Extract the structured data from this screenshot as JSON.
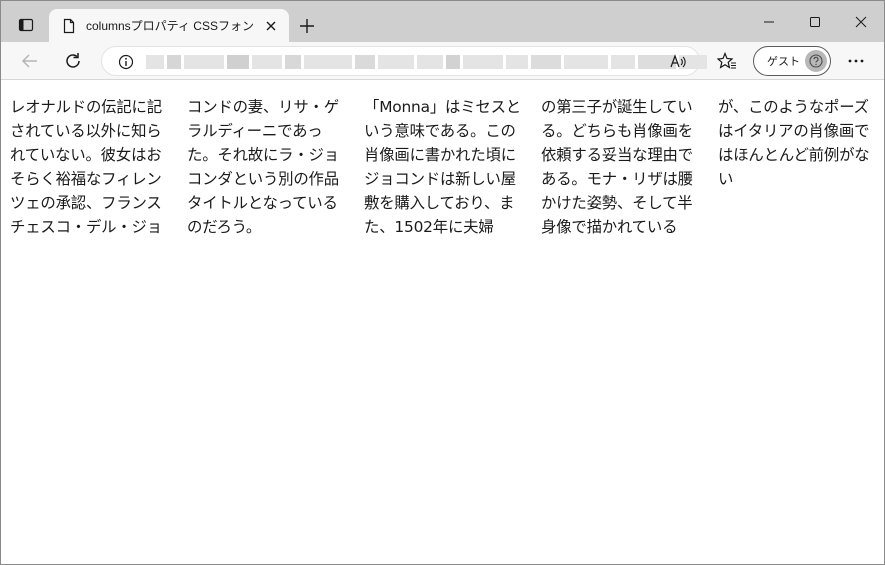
{
  "tab": {
    "title": "columnsプロパティ CSSフォントサンプル",
    "icons": {
      "tab_actions": "tab-actions-icon",
      "page": "page-icon",
      "close": "close-icon",
      "new_tab": "plus-icon"
    }
  },
  "window_controls": {
    "minimize": "minimize-icon",
    "maximize": "maximize-icon",
    "close": "close-icon"
  },
  "toolbar": {
    "back": "back-arrow-icon",
    "reload": "reload-icon",
    "info": "info-icon",
    "read_aloud": "read-aloud-icon",
    "favorites": "favorites-icon",
    "more": "more-icon",
    "guest_label": "ゲスト"
  },
  "content": {
    "columns": [
      "レオナルドの伝記に記されている以外に知られていない。彼女はおそらく裕福なフィレンツェの承認、フランスチェスコ・デル・ジョ",
      "コンドの妻、リサ・ゲラルディーニであった。それ故にラ・ジョコンダという別の作品タイトルとなっているのだろう。",
      "「Monna」はミセスという意味である。この肖像画に書かれた頃にジョコンドは新しい屋敷を購入しており、また、1502年に夫婦",
      "の第三子が誕生している。どちらも肖像画を依頼する妥当な理由である。モナ・リザは腰かけた姿勢、そして半身像で描かれている",
      "が、このようなポーズはイタリアの肖像画ではほんとんど前例がない"
    ]
  }
}
